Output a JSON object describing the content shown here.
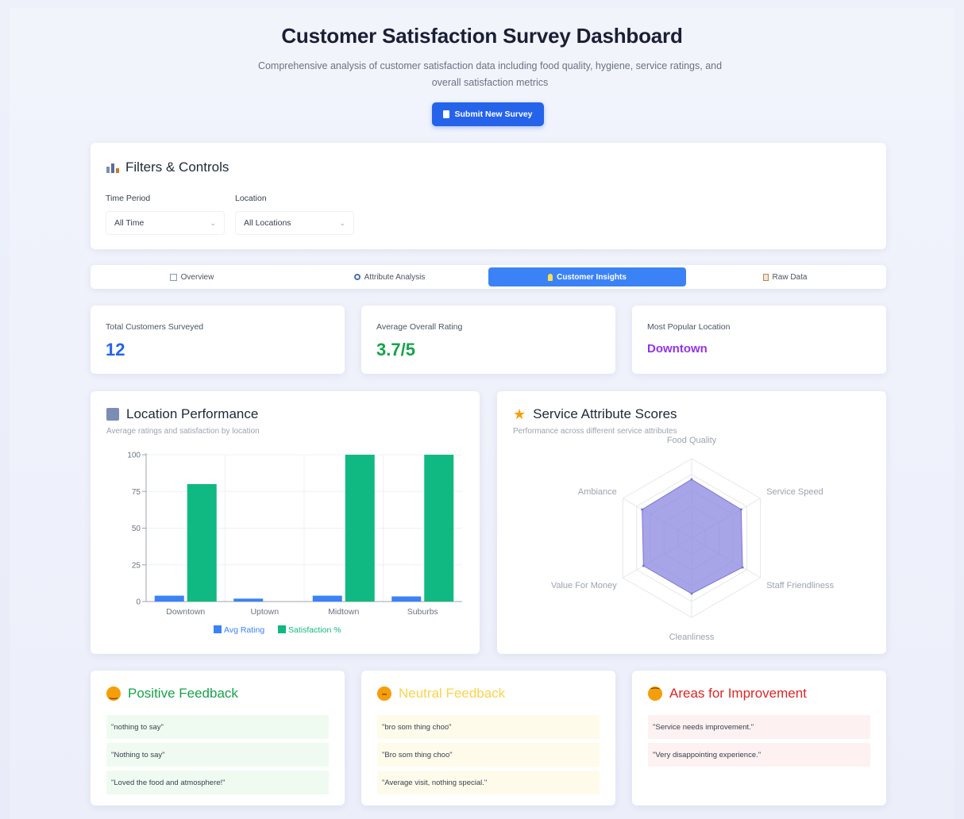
{
  "header": {
    "title": "Customer Satisfaction Survey Dashboard",
    "description": "Comprehensive analysis of customer satisfaction data including food quality, hygiene, service ratings, and overall satisfaction metrics",
    "submit_label": "Submit New Survey"
  },
  "filters": {
    "title": "Filters & Controls",
    "time_period": {
      "label": "Time Period",
      "value": "All Time"
    },
    "location": {
      "label": "Location",
      "value": "All Locations"
    }
  },
  "tabs": [
    {
      "label": "Overview",
      "icon": "bar-chart-icon",
      "active": false
    },
    {
      "label": "Attribute Analysis",
      "icon": "magnifier-icon",
      "active": false
    },
    {
      "label": "Customer Insights",
      "icon": "lightbulb-icon",
      "active": true
    },
    {
      "label": "Raw Data",
      "icon": "clipboard-icon",
      "active": false
    }
  ],
  "stats": [
    {
      "label": "Total Customers Surveyed",
      "value": "12",
      "color": "#2563eb"
    },
    {
      "label": "Average Overall Rating",
      "value": "3.7/5",
      "color": "#16a34a"
    },
    {
      "label": "Most Popular Location",
      "value": "Downtown",
      "color": "#9333ea"
    }
  ],
  "location_chart": {
    "title": "Location Performance",
    "subtitle": "Average ratings and satisfaction by location"
  },
  "radar_chart": {
    "title": "Service Attribute Scores",
    "subtitle": "Performance across different service attributes"
  },
  "chart_data": [
    {
      "type": "bar",
      "categories": [
        "Downtown",
        "Uptown",
        "Midtown",
        "Suburbs"
      ],
      "series": [
        {
          "name": "Avg Rating",
          "values": [
            4,
            2,
            4,
            3.5
          ],
          "color": "#3b82f6"
        },
        {
          "name": "Satisfaction %",
          "values": [
            80,
            0,
            100,
            100
          ],
          "color": "#10b981"
        }
      ],
      "ylim": [
        0,
        100
      ],
      "yticks": [
        0,
        25,
        50,
        75,
        100
      ],
      "grid": true,
      "legend": "bottom"
    },
    {
      "type": "radar",
      "axes": [
        "Food Quality",
        "Service Speed",
        "Staff Friendliness",
        "Cleanliness",
        "Value For Money",
        "Ambiance"
      ],
      "values": [
        3.7,
        3.6,
        3.7,
        3.5,
        3.5,
        3.6
      ],
      "rlim": [
        0,
        5
      ],
      "fill_color": "#8b85e0"
    }
  ],
  "feedback": {
    "positive": {
      "title": "Positive Feedback",
      "items": [
        "\"nothing to say\"",
        "\"Nothing to say\"",
        "\"Loved the food and atmosphere!\""
      ],
      "color": "#16a34a"
    },
    "neutral": {
      "title": "Neutral Feedback",
      "items": [
        "\"bro som thing choo\"",
        "\"Bro som thing choo\"",
        "\"Average visit, nothing special.\""
      ],
      "color": "#facc15"
    },
    "negative": {
      "title": "Areas for Improvement",
      "items": [
        "\"Service needs improvement.\"",
        "\"Very disappointing experience.\""
      ],
      "color": "#dc2626"
    }
  }
}
